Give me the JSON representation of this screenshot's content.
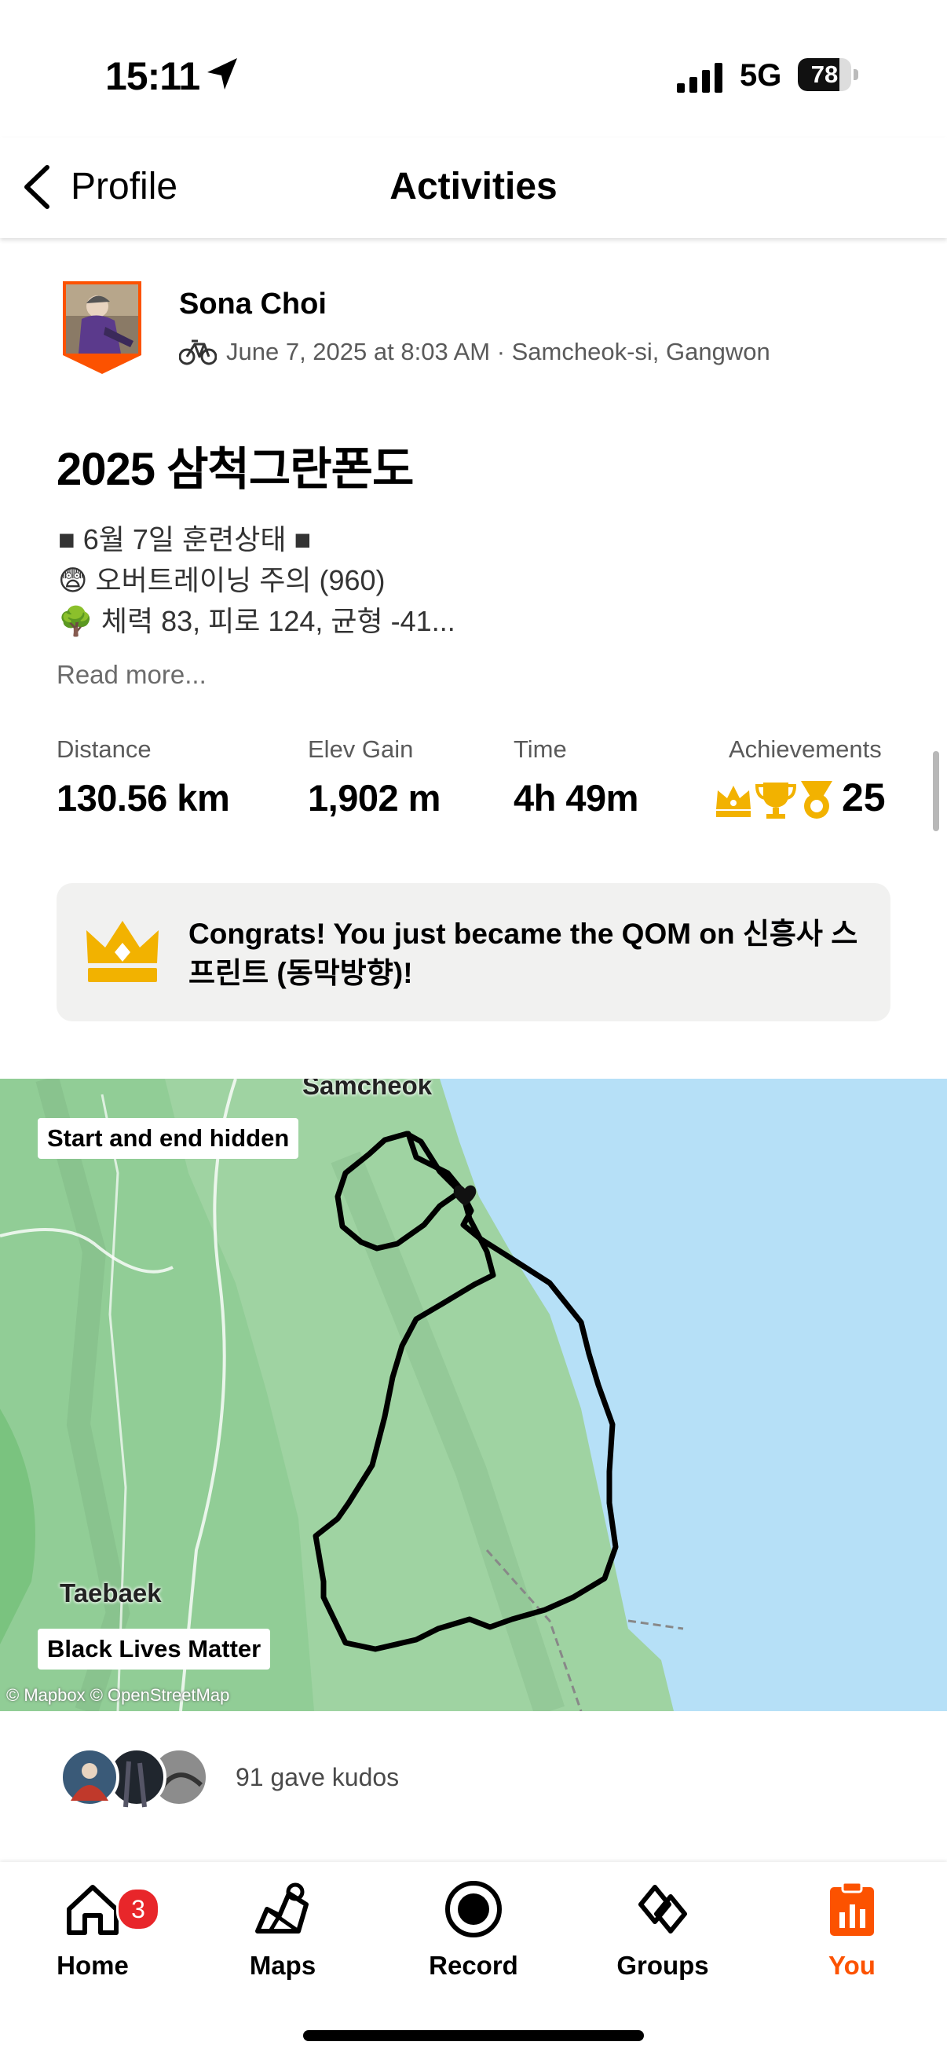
{
  "status_bar": {
    "time": "15:11",
    "network": "5G",
    "battery": "78",
    "battery_level": 0.78,
    "location_icon": "location-arrow-icon",
    "signal_icon": "cellular-signal-icon"
  },
  "nav": {
    "back_label": "Profile",
    "title": "Activities",
    "back_icon": "chevron-left-icon"
  },
  "athlete": {
    "name": "Sona Choi",
    "meta": "June 7, 2025 at 8:03 AM · Samcheok-si, Gangwon",
    "sport_icon": "bicycle-icon"
  },
  "activity": {
    "title": "2025 삼척그란폰도",
    "description": [
      "■ 6월 7일 훈련상태 ■",
      "😨 오버트레이닝 주의 (960)",
      "🌳 체력 83, 피로 124, 균형 -41..."
    ],
    "read_more": "Read more..."
  },
  "stats": [
    {
      "label": "Distance",
      "value": "130.56 km"
    },
    {
      "label": "Elev Gain",
      "value": "1,902 m"
    },
    {
      "label": "Time",
      "value": "4h 49m"
    }
  ],
  "achievements": {
    "label": "Achievements",
    "count": "25",
    "icons": [
      "crown-icon",
      "trophy-icon",
      "medal-icon"
    ]
  },
  "qom": {
    "text": "Congrats! You just became the QOM on 신흥사 스프린트 (동막방향)!",
    "icon": "crown-icon"
  },
  "map": {
    "start_end_label": "Start and end hidden",
    "banner_label": "Black Lives Matter",
    "place_1": "Samcheok",
    "place_2": "Taebaek",
    "attribution": "© Mapbox © OpenStreetMap",
    "land_color": "#9fd3a2",
    "water_color": "#b6e0f7"
  },
  "kudos": {
    "text": "91 gave kudos"
  },
  "tabbar": {
    "tabs": [
      {
        "label": "Home",
        "icon": "home-icon"
      },
      {
        "label": "Maps",
        "icon": "maps-icon"
      },
      {
        "label": "Record",
        "icon": "record-icon"
      },
      {
        "label": "Groups",
        "icon": "groups-icon"
      },
      {
        "label": "You",
        "icon": "you-icon"
      }
    ],
    "home_badge": "3",
    "active_color": "#fc5200"
  }
}
